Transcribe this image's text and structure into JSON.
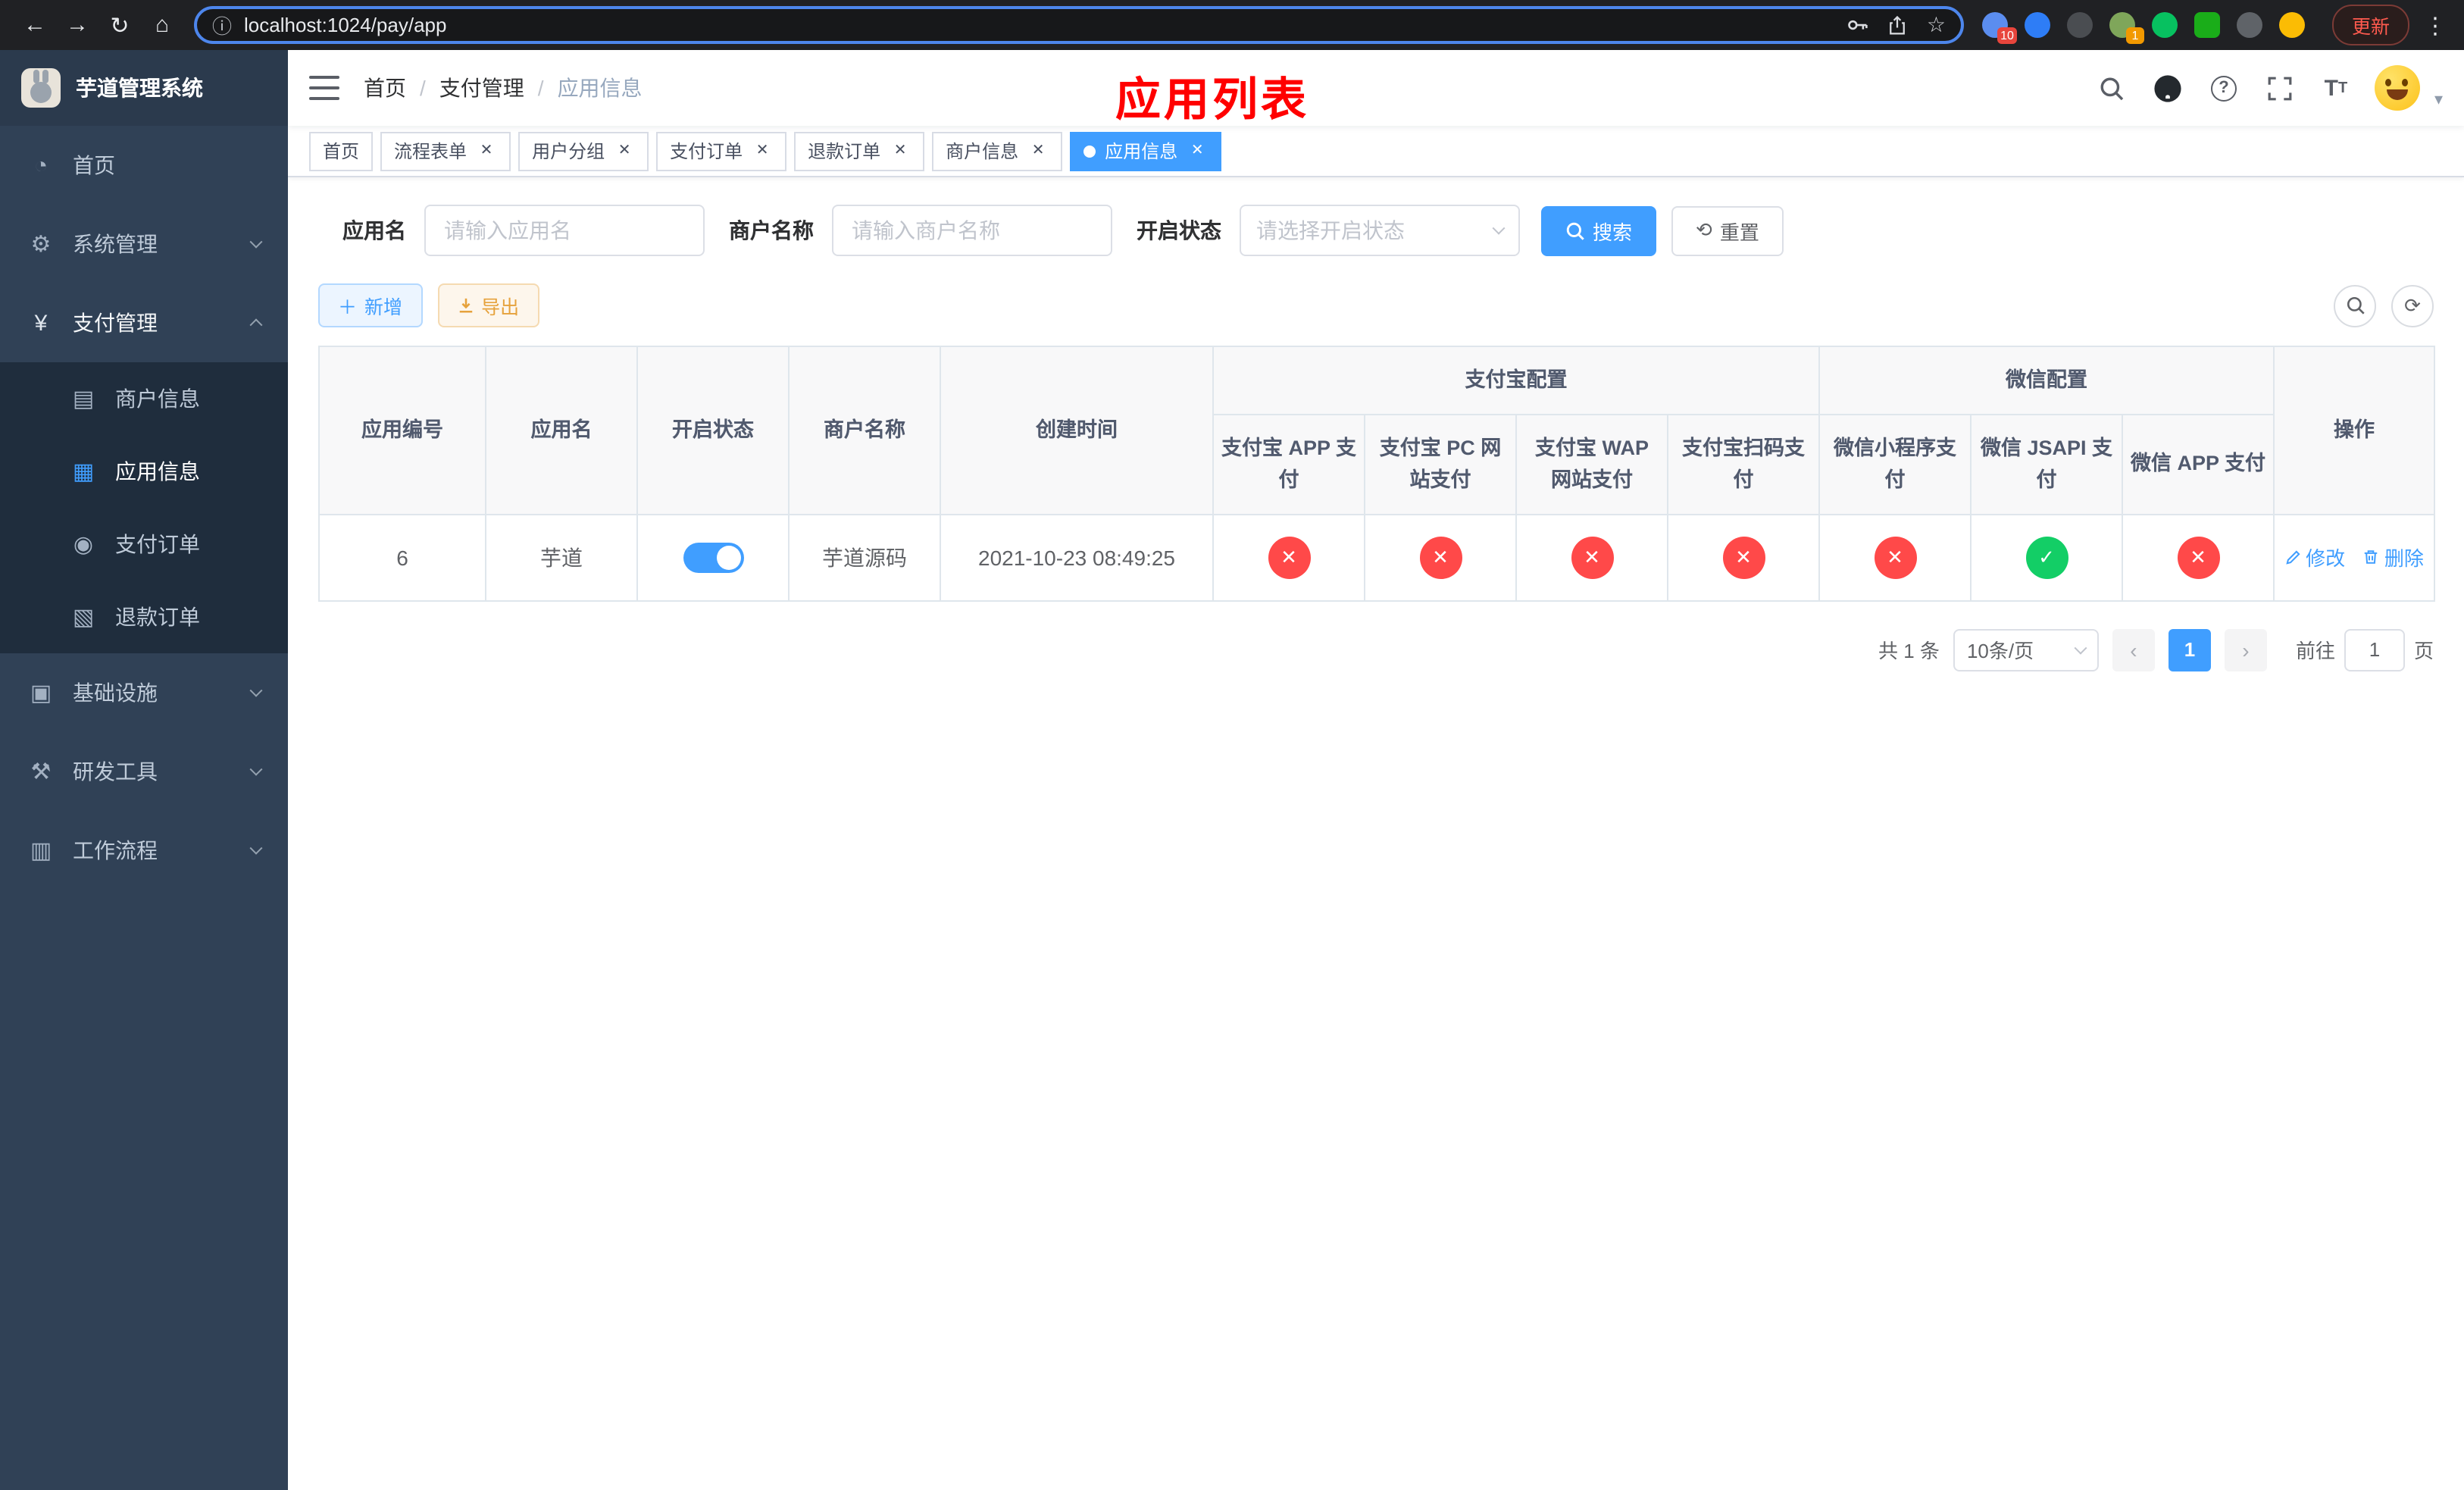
{
  "colors": {
    "accent": "#409eff",
    "danger": "#ff4949",
    "success": "#13ce66",
    "title_red": "#ff0000"
  },
  "browser": {
    "url": "localhost:1024/pay/app",
    "update_label": "更新",
    "extensions": [
      {
        "name": "extension-blue",
        "color": "#5b8def",
        "badge": "10",
        "badge_color": "#e8453c"
      },
      {
        "name": "extension-drop",
        "color": "#2e7df6",
        "badge": ""
      },
      {
        "name": "extension-dark-circle",
        "color": "#4a4d51",
        "badge": ""
      },
      {
        "name": "extension-avatar",
        "color": "#7fa65a",
        "badge": "1",
        "badge_color": "#f29900"
      },
      {
        "name": "extension-green-circle",
        "color": "#07c160",
        "badge": ""
      },
      {
        "name": "extension-green-square",
        "color": "#1aad19",
        "badge": ""
      },
      {
        "name": "extension-dark-tool",
        "color": "#5f6368",
        "badge": ""
      },
      {
        "name": "extension-emoji",
        "color": "#fbbc04",
        "badge": ""
      }
    ]
  },
  "sidebar": {
    "app_title": "芋道管理系统",
    "items": [
      {
        "label": "首页"
      },
      {
        "label": "系统管理"
      },
      {
        "label": "支付管理"
      },
      {
        "label": "基础设施"
      },
      {
        "label": "研发工具"
      },
      {
        "label": "工作流程"
      }
    ],
    "submenu": [
      {
        "label": "商户信息"
      },
      {
        "label": "应用信息"
      },
      {
        "label": "支付订单"
      },
      {
        "label": "退款订单"
      }
    ]
  },
  "header": {
    "breadcrumb": [
      "首页",
      "支付管理",
      "应用信息"
    ],
    "page_title": "应用列表"
  },
  "tabs": [
    {
      "label": "首页"
    },
    {
      "label": "流程表单"
    },
    {
      "label": "用户分组"
    },
    {
      "label": "支付订单"
    },
    {
      "label": "退款订单"
    },
    {
      "label": "商户信息"
    },
    {
      "label": "应用信息"
    }
  ],
  "filters": {
    "app_name_label": "应用名",
    "app_name_placeholder": "请输入应用名",
    "merchant_label": "商户名称",
    "merchant_placeholder": "请输入商户名称",
    "status_label": "开启状态",
    "status_placeholder": "请选择开启状态",
    "search_label": "搜索",
    "reset_label": "重置"
  },
  "toolbar": {
    "add_label": "新增",
    "export_label": "导出"
  },
  "table": {
    "columns": {
      "app_id": "应用编号",
      "app_name": "应用名",
      "status": "开启状态",
      "merchant": "商户名称",
      "created": "创建时间",
      "alipay_group": "支付宝配置",
      "wechat_group": "微信配置",
      "alipay_app": "支付宝 APP 支付",
      "alipay_pc": "支付宝 PC 网站支付",
      "alipay_wap": "支付宝 WAP 网站支付",
      "alipay_qr": "支付宝扫码支付",
      "wx_mini": "微信小程序支付",
      "wx_jsapi": "微信 JSAPI 支付",
      "wx_app": "微信 APP 支付",
      "actions": "操作"
    },
    "rows": [
      {
        "app_id": "6",
        "app_name": "芋道",
        "status_on": true,
        "merchant": "芋道源码",
        "created": "2021-10-23 08:49:25",
        "configs": {
          "alipay_app": false,
          "alipay_pc": false,
          "alipay_wap": false,
          "alipay_qr": false,
          "wx_mini": false,
          "wx_jsapi": true,
          "wx_app": false
        },
        "edit_label": "修改",
        "delete_label": "删除"
      }
    ]
  },
  "pagination": {
    "total": "共 1 条",
    "page_size": "10条/页",
    "page": "1",
    "goto_label": "前往",
    "goto_value": "1",
    "goto_suffix": "页"
  }
}
